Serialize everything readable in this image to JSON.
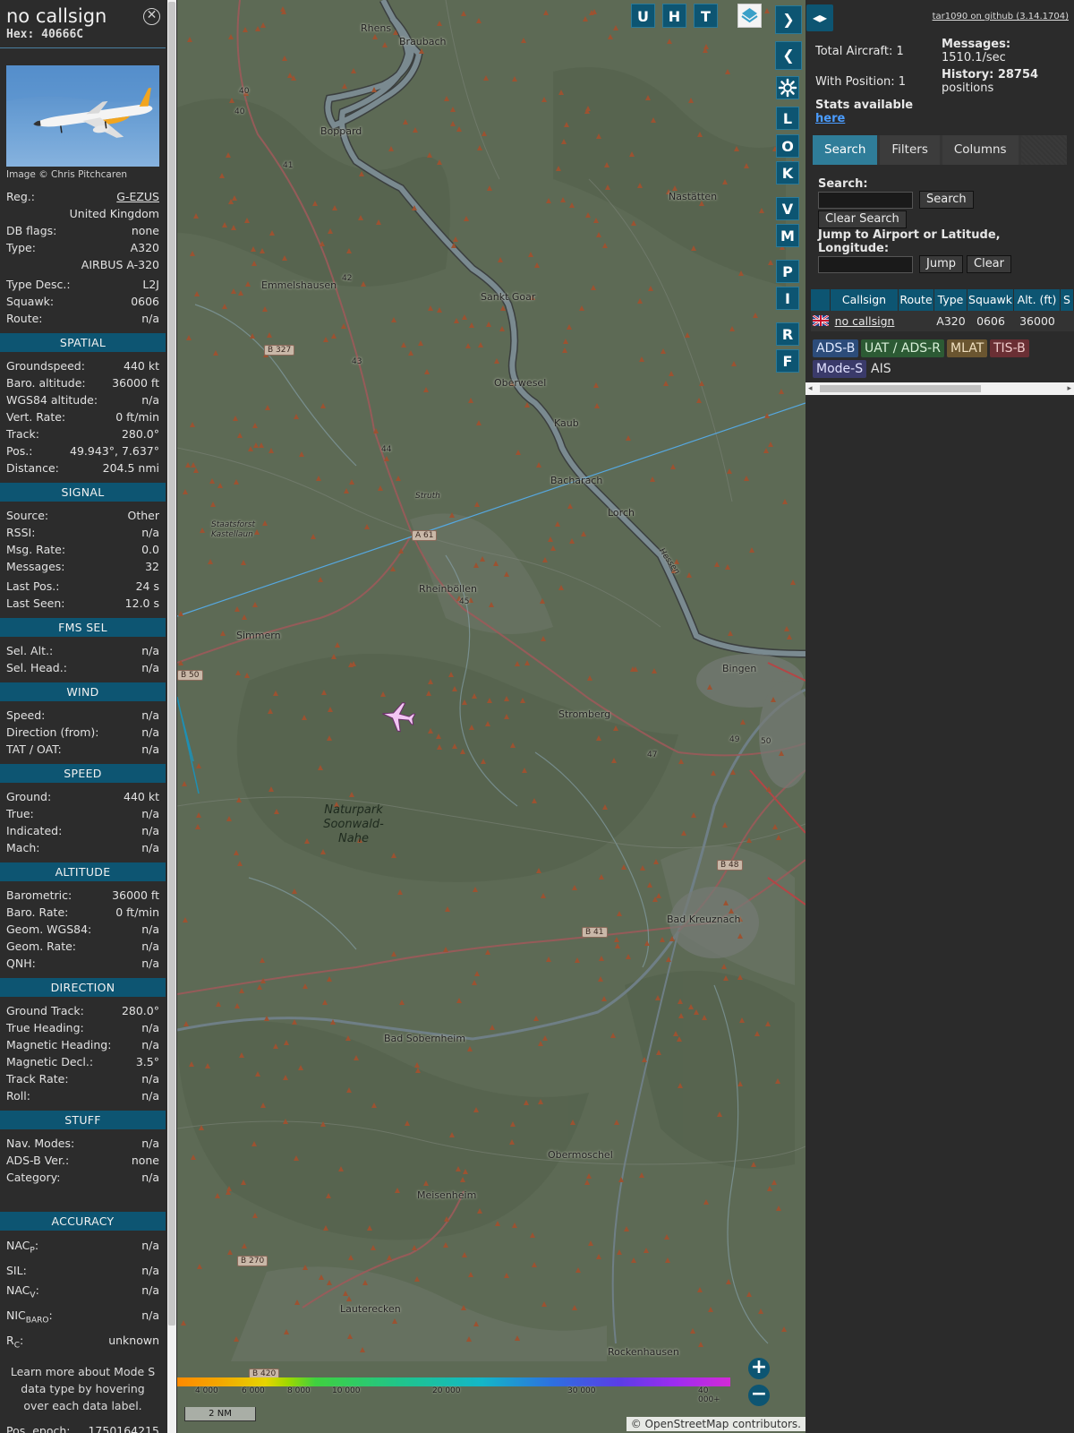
{
  "aircraft": {
    "callsign": "no callsign",
    "hex": "Hex: 40666C",
    "image_credit": "Image © Chris Pitchcaren"
  },
  "info": {
    "basic": [
      {
        "k": "Reg.:",
        "v": "G-EZUS",
        "link": true
      },
      {
        "k": "",
        "v": "United Kingdom"
      },
      {
        "k": "DB flags:",
        "v": "none"
      },
      {
        "k": "Type:",
        "v": "A320"
      },
      {
        "k": "",
        "v": "AIRBUS A-320"
      },
      {
        "k": "Type Desc.:",
        "v": "L2J",
        "gap": true
      },
      {
        "k": "Squawk:",
        "v": "0606"
      },
      {
        "k": "Route:",
        "v": "n/a"
      }
    ],
    "sections": [
      {
        "title": "SPATIAL",
        "rows": [
          {
            "k": "Groundspeed:",
            "v": "440 kt"
          },
          {
            "k": "Baro. altitude:",
            "v": "36000 ft"
          },
          {
            "k": "WGS84 altitude:",
            "v": "n/a"
          },
          {
            "k": "Vert. Rate:",
            "v": "0 ft/min"
          },
          {
            "k": "Track:",
            "v": "280.0°"
          },
          {
            "k": "Pos.:",
            "v": "49.943°, 7.637°"
          },
          {
            "k": "Distance:",
            "v": "204.5 nmi"
          }
        ]
      },
      {
        "title": "SIGNAL",
        "rows": [
          {
            "k": "Source:",
            "v": "Other"
          },
          {
            "k": "RSSI:",
            "v": "n/a"
          },
          {
            "k": "Msg. Rate:",
            "v": "0.0"
          },
          {
            "k": "Messages:",
            "v": "32"
          },
          {
            "k": "Last Pos.:",
            "v": "24 s",
            "gap": true
          },
          {
            "k": "Last Seen:",
            "v": "12.0 s"
          }
        ]
      },
      {
        "title": "FMS SEL",
        "rows": [
          {
            "k": "Sel. Alt.:",
            "v": "n/a"
          },
          {
            "k": "Sel. Head.:",
            "v": "n/a"
          }
        ]
      },
      {
        "title": "WIND",
        "rows": [
          {
            "k": "Speed:",
            "v": "n/a"
          },
          {
            "k": "Direction (from):",
            "v": "n/a"
          },
          {
            "k": "TAT / OAT:",
            "v": "n/a"
          }
        ]
      },
      {
        "title": "SPEED",
        "rows": [
          {
            "k": "Ground:",
            "v": "440 kt"
          },
          {
            "k": "True:",
            "v": "n/a"
          },
          {
            "k": "Indicated:",
            "v": "n/a"
          },
          {
            "k": "Mach:",
            "v": "n/a"
          }
        ]
      },
      {
        "title": "ALTITUDE",
        "rows": [
          {
            "k": "Barometric:",
            "v": "36000 ft"
          },
          {
            "k": "Baro. Rate:",
            "v": "0 ft/min"
          },
          {
            "k": "Geom. WGS84:",
            "v": "n/a"
          },
          {
            "k": "Geom. Rate:",
            "v": "n/a"
          },
          {
            "k": "QNH:",
            "v": "n/a"
          }
        ]
      },
      {
        "title": "DIRECTION",
        "rows": [
          {
            "k": "Ground Track:",
            "v": "280.0°"
          },
          {
            "k": "True Heading:",
            "v": "n/a"
          },
          {
            "k": "Magnetic Heading:",
            "v": "n/a"
          },
          {
            "k": "Magnetic Decl.:",
            "v": "3.5°"
          },
          {
            "k": "Track Rate:",
            "v": "n/a"
          },
          {
            "k": "Roll:",
            "v": "n/a"
          }
        ]
      },
      {
        "title": "STUFF",
        "rows": [
          {
            "k": "Nav. Modes:",
            "v": "n/a"
          },
          {
            "k": "ADS-B Ver.:",
            "v": "none"
          },
          {
            "k": "Category:",
            "v": "n/a"
          }
        ]
      },
      {
        "title": "ACCURACY",
        "spaced": true,
        "rows": [
          {
            "k": "NAC",
            "sub": "P",
            "v": "n/a"
          },
          {
            "k": "SIL:",
            "v": "n/a"
          },
          {
            "k": "NAC",
            "sub": "V",
            "v": "n/a"
          },
          {
            "k": "NIC",
            "sub": "BARO",
            "v": "n/a"
          },
          {
            "k": "R",
            "sub": "C",
            "v": "unknown"
          }
        ]
      }
    ],
    "note": "Learn more about Mode S data type by hovering over each data label.",
    "epoch": {
      "k": "Pos. epoch:",
      "v": "1750164215"
    }
  },
  "map": {
    "buttons_top": [
      "U",
      "H",
      "T"
    ],
    "buttons_side": [
      "L",
      "O",
      "K",
      "V",
      "M",
      "P",
      "I",
      "R",
      "F"
    ],
    "towns": [
      "Rhens",
      "Braubach",
      "Boppard",
      "Nastätten",
      "Emmelshausen",
      "Sankt Goar",
      "Oberwesel",
      "Kaub",
      "Bacharach",
      "Lorch",
      "Rheinböllen",
      "Simmern",
      "Bingen",
      "Stromberg",
      "Bad Kreuznach",
      "Bad Sobernheim",
      "Obermoschel",
      "Meisenheim",
      "Lauterecken",
      "Rockenhausen"
    ],
    "small_labels": [
      "Struth",
      "Staatsforst Kastellaun",
      "Hessen"
    ],
    "roads": [
      "B 327",
      "A 61",
      "B 50",
      "B 48",
      "B 41",
      "B 270",
      "B 420"
    ],
    "road_numbers": [
      "40",
      "40",
      "41",
      "42",
      "43",
      "44",
      "45",
      "47",
      "49",
      "50"
    ],
    "park_label": "Naturpark Soonwald-Nahe",
    "legend_ticks": [
      "4 000",
      "6 000",
      "8 000",
      "10 000",
      "20 000",
      "30 000",
      "40 000+"
    ],
    "scale": "2 NM",
    "attribution": "© OpenStreetMap contributors."
  },
  "right": {
    "github": "tar1090 on github (3.14.1704)",
    "total_aircraft": "Total Aircraft: 1",
    "with_position": "With Position: 1",
    "messages_label": "Messages:",
    "messages_value": "1510.1/sec",
    "history_label": "History: 28754",
    "history_value": "positions",
    "stats_text": "Stats available",
    "stats_link": "here",
    "tabs": [
      "Search",
      "Filters",
      "Columns"
    ],
    "search_label": "Search:",
    "search_button": "Search",
    "clear_search_button": "Clear Search",
    "jump_label": "Jump to Airport or Latitude, Longitude:",
    "jump_button": "Jump",
    "clear_button": "Clear",
    "table": {
      "headers": [
        "",
        "Callsign",
        "Route",
        "Type",
        "Squawk",
        "Alt. (ft)",
        "S"
      ],
      "row": {
        "callsign": "no callsign",
        "route": "",
        "type": "A320",
        "squawk": "0606",
        "alt": "36000"
      }
    },
    "sources": [
      "ADS-B",
      "UAT / ADS-R",
      "MLAT",
      "TIS-B",
      "Mode-S",
      "AIS"
    ]
  },
  "colors": {
    "accent": "#0d5572",
    "panel": "#2b2b2b",
    "active_tab": "#2f7d99"
  }
}
